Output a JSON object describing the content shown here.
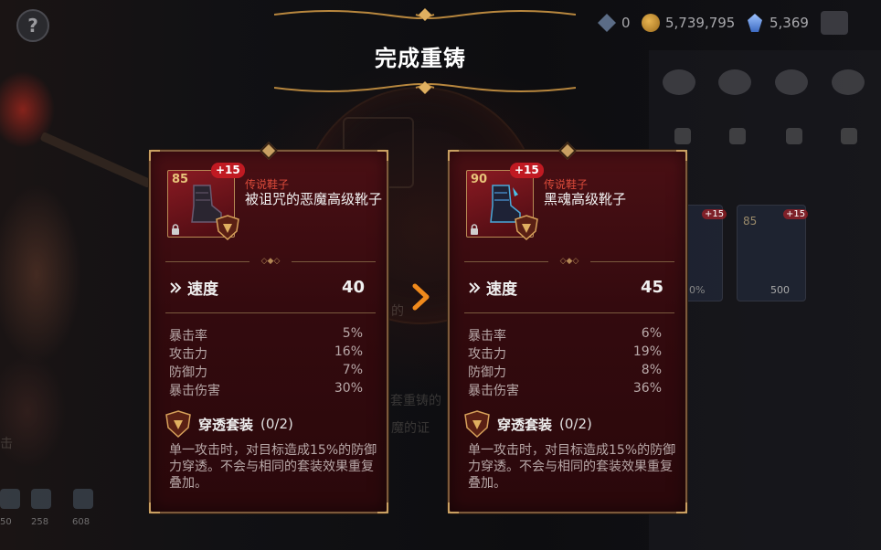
{
  "title": "完成重铸",
  "help": "?",
  "currencies": [
    {
      "icon": "gem-icon",
      "value": "0"
    },
    {
      "icon": "gold-coin-icon",
      "value": "5,739,795"
    },
    {
      "icon": "crystal-icon",
      "value": "5,369"
    }
  ],
  "background": {
    "bottom_counts": [
      "50",
      "258",
      "608"
    ],
    "cards": [
      {
        "text": "0%"
      },
      {
        "text": "500"
      }
    ],
    "card_levels": [
      "85"
    ],
    "plus_badges": [
      "+15",
      "+15"
    ],
    "ghost_texts": [
      "的"
    ],
    "ghost_text_2": "魔的证",
    "ghost_text_3": "套重铸的",
    "ghost_text_4": "击"
  },
  "before": {
    "level": "85",
    "plus": "+15",
    "type": "传说鞋子",
    "name": "被诅咒的恶魔高级靴子",
    "main_stat": {
      "label": "速度",
      "value": "40"
    },
    "sub_stats": [
      {
        "label": "暴击率",
        "value": "5%"
      },
      {
        "label": "攻击力",
        "value": "16%"
      },
      {
        "label": "防御力",
        "value": "7%"
      },
      {
        "label": "暴击伤害",
        "value": "30%"
      }
    ],
    "set": {
      "name": "穿透套装",
      "count": "(0/2)",
      "desc": "单一攻击时，对目标造成15%的防御力穿透。不会与相同的套装效果重复叠加。"
    }
  },
  "after": {
    "level": "90",
    "plus": "+15",
    "type": "传说鞋子",
    "name": "黑魂高级靴子",
    "main_stat": {
      "label": "速度",
      "value": "45"
    },
    "sub_stats": [
      {
        "label": "暴击率",
        "value": "6%"
      },
      {
        "label": "攻击力",
        "value": "19%"
      },
      {
        "label": "防御力",
        "value": "8%"
      },
      {
        "label": "暴击伤害",
        "value": "36%"
      }
    ],
    "set": {
      "name": "穿透套装",
      "count": "(0/2)",
      "desc": "单一攻击时，对目标造成15%的防御力穿透。不会与相同的套装效果重复叠加。"
    }
  },
  "colors": {
    "card_bg": "#4a0f14",
    "card_border": "#7c5a3b",
    "gold_accent": "#c9a062",
    "rarity_red": "#d94a3a",
    "arrow_orange": "#f08a1c"
  }
}
